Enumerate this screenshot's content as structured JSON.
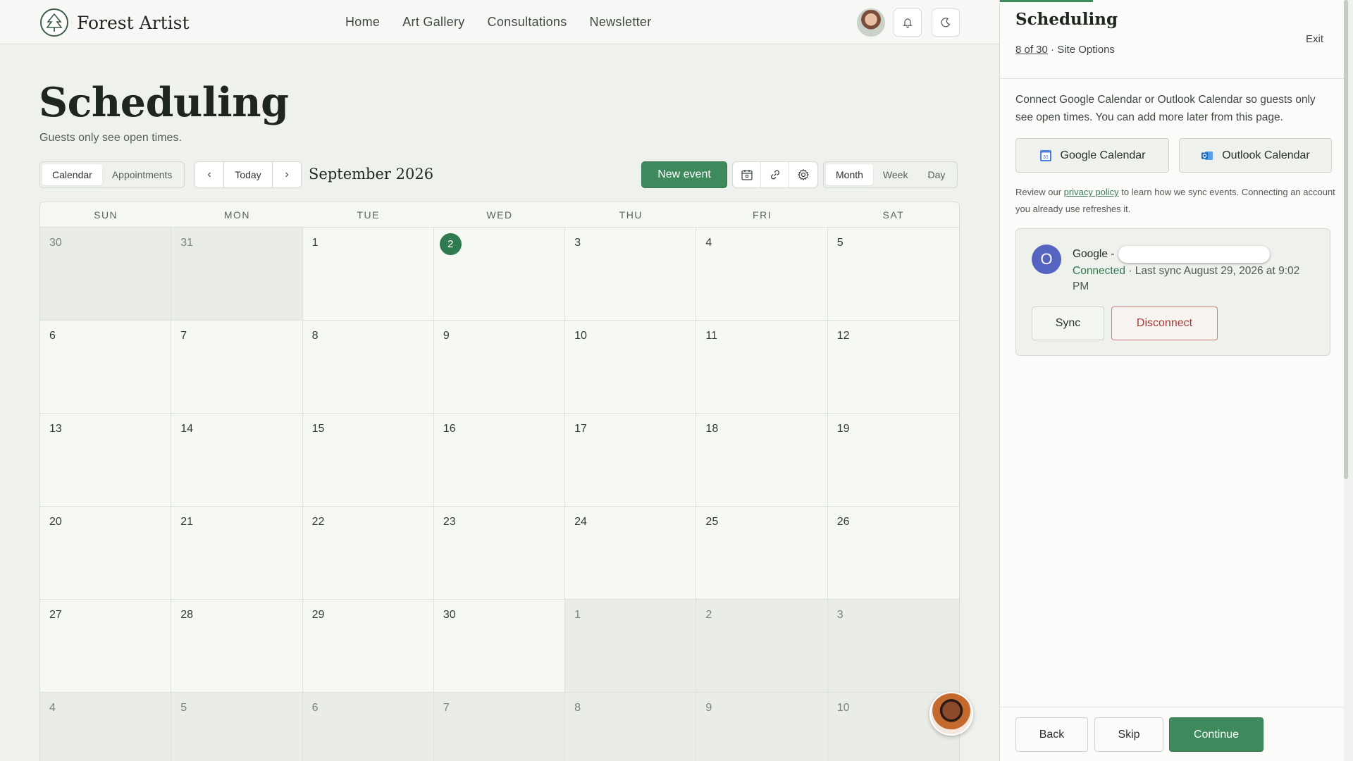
{
  "app": {
    "brand": "Forest Artist",
    "nav": [
      "Home",
      "Art Gallery",
      "Consultations",
      "Newsletter"
    ]
  },
  "page": {
    "title": "Scheduling",
    "subtitle": "Guests only see open times."
  },
  "toolbar": {
    "view_tabs": [
      "Calendar",
      "Appointments"
    ],
    "active_view_tab": "Calendar",
    "today_label": "Today",
    "prev_label": "‹",
    "next_label": "›",
    "month_label": "September 2026",
    "new_event_label": "New event",
    "range_tabs": [
      "Month",
      "Week",
      "Day"
    ],
    "active_range_tab": "Month"
  },
  "calendar": {
    "weekdays": [
      "SUN",
      "MON",
      "TUE",
      "WED",
      "THU",
      "FRI",
      "SAT"
    ],
    "days": [
      {
        "n": "30",
        "muted": true
      },
      {
        "n": "31",
        "muted": true
      },
      {
        "n": "1"
      },
      {
        "n": "2",
        "today": true
      },
      {
        "n": "3"
      },
      {
        "n": "4"
      },
      {
        "n": "5"
      },
      {
        "n": "6"
      },
      {
        "n": "7"
      },
      {
        "n": "8"
      },
      {
        "n": "9"
      },
      {
        "n": "10"
      },
      {
        "n": "11"
      },
      {
        "n": "12"
      },
      {
        "n": "13"
      },
      {
        "n": "14"
      },
      {
        "n": "15"
      },
      {
        "n": "16"
      },
      {
        "n": "17"
      },
      {
        "n": "18"
      },
      {
        "n": "19"
      },
      {
        "n": "20"
      },
      {
        "n": "21"
      },
      {
        "n": "22"
      },
      {
        "n": "23"
      },
      {
        "n": "24"
      },
      {
        "n": "25"
      },
      {
        "n": "26"
      },
      {
        "n": "27"
      },
      {
        "n": "28"
      },
      {
        "n": "29"
      },
      {
        "n": "30"
      },
      {
        "n": "1",
        "muted": true
      },
      {
        "n": "2",
        "muted": true
      },
      {
        "n": "3",
        "muted": true
      },
      {
        "n": "4",
        "muted": true
      },
      {
        "n": "5",
        "muted": true
      },
      {
        "n": "6",
        "muted": true
      },
      {
        "n": "7",
        "muted": true
      },
      {
        "n": "8",
        "muted": true
      },
      {
        "n": "9",
        "muted": true
      },
      {
        "n": "10",
        "muted": true
      }
    ]
  },
  "panel": {
    "title": "Scheduling",
    "exit_label": "Exit",
    "step_count": "8 of 30",
    "step_label": "· Site Options",
    "intro": "Connect Google Calendar or Outlook Calendar so guests only see open times. You can add more later from this page.",
    "google_btn": "Google Calendar",
    "outlook_btn": "Outlook Calendar",
    "privacy_pre": "Review our ",
    "privacy_link": "privacy policy",
    "privacy_post": " to learn how we sync events. Connecting an account you already use refreshes it.",
    "account": {
      "initial": "O",
      "provider": "Google -",
      "status": "Connected",
      "last_sync": " · Last sync August 29, 2026 at 9:02 PM"
    },
    "sync_btn": "Sync",
    "disconnect_btn": "Disconnect",
    "back_btn": "Back",
    "skip_btn": "Skip",
    "continue_btn": "Continue"
  },
  "colors": {
    "accent": "#3e8a5c",
    "danger": "#a33a34",
    "today_marker": "#2f7a4e"
  }
}
